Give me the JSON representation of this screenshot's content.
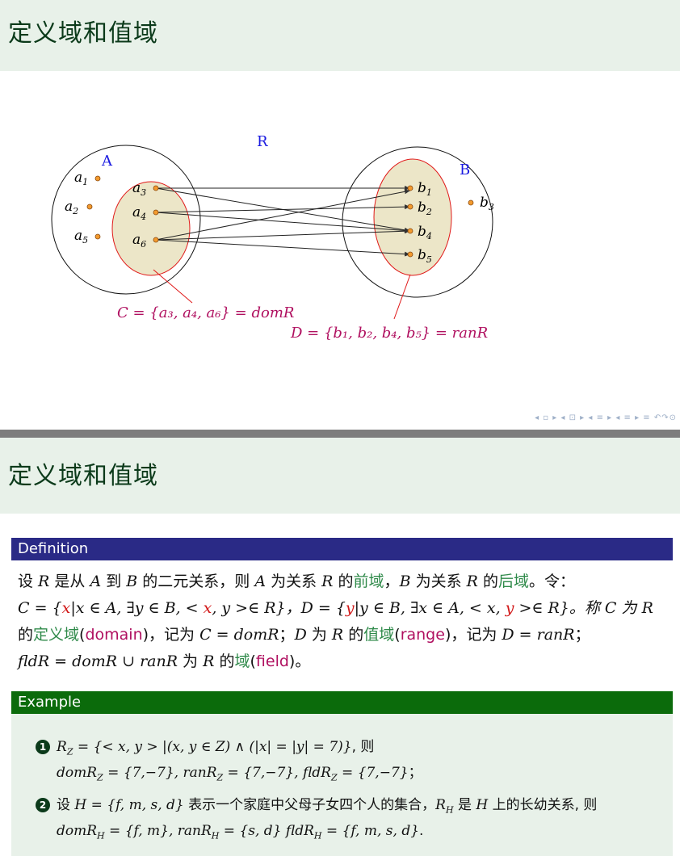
{
  "slide1": {
    "title": "定义域和值域",
    "relation_label": "R",
    "set_a_label": "A",
    "set_b_label": "B",
    "a_outer": [
      {
        "name": "a",
        "sub": "1"
      },
      {
        "name": "a",
        "sub": "2"
      },
      {
        "name": "a",
        "sub": "5"
      }
    ],
    "a_inner": [
      {
        "name": "a",
        "sub": "3"
      },
      {
        "name": "a",
        "sub": "4"
      },
      {
        "name": "a",
        "sub": "6"
      }
    ],
    "b_inner": [
      {
        "name": "b",
        "sub": "1"
      },
      {
        "name": "b",
        "sub": "2"
      },
      {
        "name": "b",
        "sub": "4"
      },
      {
        "name": "b",
        "sub": "5"
      }
    ],
    "b_outer": [
      {
        "name": "b",
        "sub": "3"
      }
    ],
    "edges": [
      [
        "a3",
        "b1"
      ],
      [
        "a3",
        "b4"
      ],
      [
        "a4",
        "b2"
      ],
      [
        "a4",
        "b4"
      ],
      [
        "a6",
        "b4"
      ],
      [
        "a6",
        "b5"
      ],
      [
        "a6",
        "b1"
      ]
    ],
    "domain_formula": "C = {a₃, a₄, a₆} = domR",
    "range_formula": "D = {b₁, b₂, b₄, b₅} = ranR",
    "nav_glyphs": "◂ ▫ ▸ ◂ ⊡ ▸ ◂ ≡ ▸ ◂ ≡ ▸  ≡  ↶↷⊙"
  },
  "slide2": {
    "title": "定义域和值域",
    "definition_label": "Definition",
    "definition": {
      "line1_a": "设 ",
      "R1": "R",
      "line1_b": " 是从 ",
      "A1": "A",
      "line1_c": " 到 ",
      "B1": "B",
      "line1_d": " 的二元关系，则 ",
      "A2": "A",
      "line1_e": " 为关系 ",
      "R2": "R",
      "line1_f": " 的",
      "qianyu": "前域",
      "line1_g": "，",
      "B2": "B",
      "line1_h": " 为关系 ",
      "R3": "R",
      "line1_i": " 的",
      "houyu": "后域",
      "line1_j": "。令：",
      "line2_a": "C = {",
      "x1": "x",
      "line2_b": "|x ∈ A, ∃y ∈ B, < ",
      "x2": "x",
      "line2_c": ", y >∈ R}，D = {",
      "y1": "y",
      "line2_d": "|y ∈ B, ∃x ∈ A, < x, ",
      "y2": "y",
      "line2_e": " >∈ R}。称 ",
      "C": "C",
      "line2_f": " 为 ",
      "R4": "R",
      "line3_a": "的",
      "dingyiyu": "定义域",
      "line3_b": "(",
      "domain": "domain",
      "line3_c": ")，记为 ",
      "line3_d": "C = domR",
      "line3_e": "；",
      "line3_f": "D",
      "line3_g": " 为 ",
      "R5": "R",
      "line3_h": " 的",
      "zhiyu": "值域",
      "line3_i": "(",
      "range": "range",
      "line3_j": ")，记为 ",
      "line3_k": "D = ranR",
      "line3_l": "；",
      "line4_a": "fldR = domR ∪ ranR",
      "line4_b": " 为 ",
      "R6": "R",
      "line4_c": " 的",
      "yu": "域",
      "line4_d": "(",
      "field": "field",
      "line4_e": ")。"
    },
    "example_label": "Example",
    "examples": [
      {
        "number": "1",
        "line1": "R_Z = {< x, y > |(x, y ∈ Z) ∧ (|x| = |y| = 7)}, 则",
        "line1_math": "R",
        "line1_sub": "Z",
        "line1_rest": " = {< x, y > |(x, y ∈ Z) ∧ (|x| = |y| = 7)}",
        "line1_tail": ", 则",
        "line2": "domR_Z = {7,−7}, ranR_Z = {7,−7}, fldR_Z = {7,−7}；",
        "line2_p1": "domR",
        "line2_s1": "Z",
        "line2_v1": " = {7,−7}, ",
        "line2_p2": "ranR",
        "line2_s2": "Z",
        "line2_v2": " = {7,−7}, ",
        "line2_p3": "fldR",
        "line2_s3": "Z",
        "line2_v3": " = {7,−7}",
        "line2_tail": "；"
      },
      {
        "number": "2",
        "line1_a": "设 ",
        "line1_b": "H = {f, m, s, d}",
        "line1_c": " 表示一个家庭中父母子女四个人的集合，",
        "line1_d": "R",
        "line1_dsub": "H",
        "line1_e": " 是 ",
        "line1_f": "H",
        "line1_g": " 上的长幼关系, 则",
        "line2_p1": "domR",
        "line2_s1": "H",
        "line2_v1": " = {f, m}, ",
        "line2_p2": "ranR",
        "line2_s2": "H",
        "line2_v2": " = {s, d} ",
        "line2_p3": "fldR",
        "line2_s3": "H",
        "line2_v3": " = {f, m, s, d}",
        "line2_tail": "."
      }
    ]
  }
}
